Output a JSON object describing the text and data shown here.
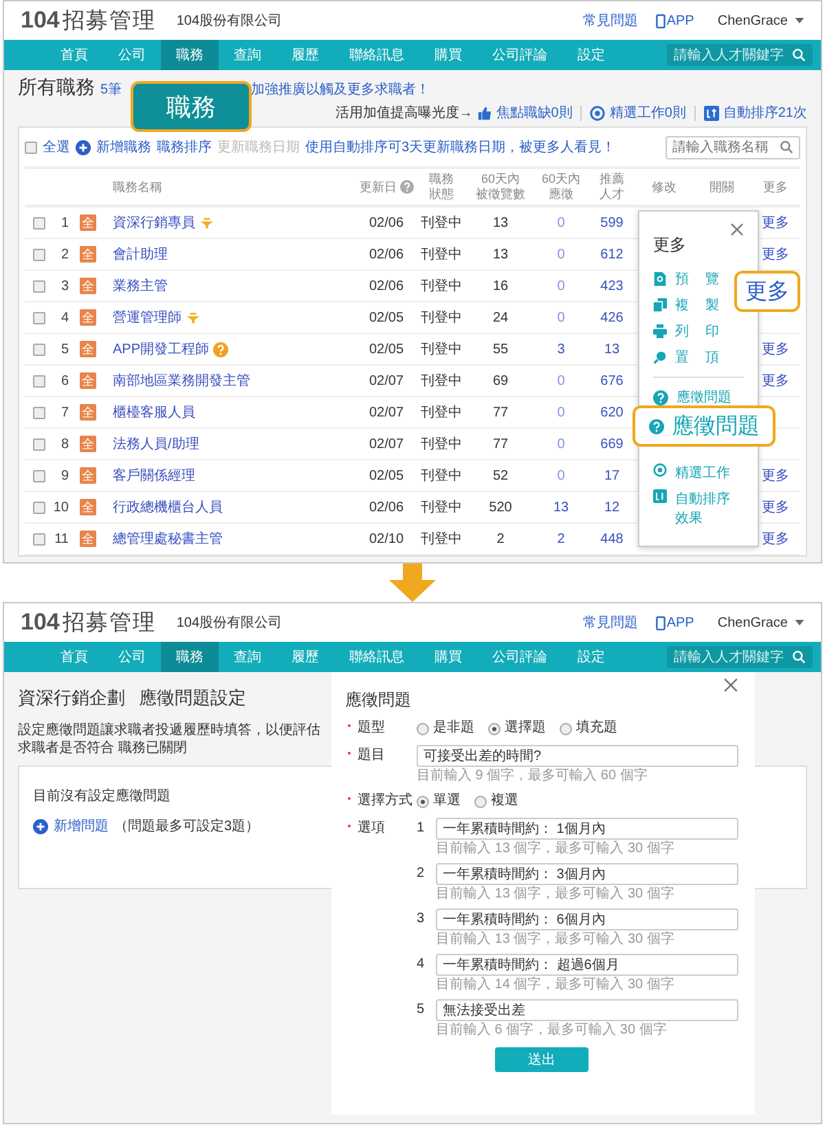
{
  "top": {
    "header": {
      "logo_number": "104",
      "logo_text": "招募管理",
      "company": "104股份有限公司",
      "faq": "常見問題",
      "app": "APP",
      "user": "ChenGrace"
    },
    "nav": {
      "items": [
        {
          "label": "首頁",
          "selected": false
        },
        {
          "label": "公司",
          "selected": false
        },
        {
          "label": "職務",
          "selected": true
        },
        {
          "label": "查詢",
          "selected": false
        },
        {
          "label": "履歷",
          "selected": false
        },
        {
          "label": "聯絡訊息",
          "selected": false
        },
        {
          "label": "購買",
          "selected": false
        },
        {
          "label": "公司評論",
          "selected": false
        },
        {
          "label": "設定",
          "selected": false
        }
      ],
      "search_placeholder": "請輸入人才關鍵字"
    },
    "page_title": "所有職務",
    "promo_start": "5筆",
    "promo_end": "加強推廣以觸及更多求職者！",
    "boost_label": "活用加值提高曝光度→",
    "boost_links": [
      "焦點職缺0則",
      "精選工作0則",
      "自動排序21次"
    ],
    "toolbar": {
      "select_all": "全選",
      "checked": false,
      "add": "新增職務",
      "sort": "職務排序",
      "update": "更新職務日期",
      "update_disabled": true,
      "tip": "使用自動排序可3天更新職務日期，被更多人看見！",
      "search_placeholder": "請輸入職務名稱"
    },
    "table": {
      "columns": [
        "職務名稱",
        "更新日",
        "職務狀態",
        "60天內被徵覽數",
        "60天內應徵",
        "推薦人才",
        "修改",
        "開關",
        "更多"
      ],
      "rows": [
        {
          "num": "1",
          "checked": false,
          "badge": "全",
          "name": "資深行銷專員",
          "featured": true,
          "date": "02/06",
          "status": "刊登中",
          "views": "13",
          "applied": "0",
          "recommend": "599",
          "more": "更多"
        },
        {
          "num": "2",
          "checked": false,
          "badge": "全",
          "name": "會計助理",
          "date": "02/06",
          "status": "刊登中",
          "views": "13",
          "applied": "0",
          "recommend": "612",
          "more": "更多"
        },
        {
          "num": "3",
          "checked": false,
          "badge": "全",
          "name": "業務主管",
          "date": "02/06",
          "status": "刊登中",
          "views": "16",
          "applied": "0",
          "recommend": "423"
        },
        {
          "num": "4",
          "checked": false,
          "badge": "全",
          "name": "營運管理師",
          "featured": true,
          "date": "02/05",
          "status": "刊登中",
          "views": "24",
          "applied": "0",
          "recommend": "426"
        },
        {
          "num": "5",
          "checked": false,
          "badge": "全",
          "name": "APP開發工程師",
          "has_questions": true,
          "date": "02/05",
          "status": "刊登中",
          "views": "55",
          "applied": "3",
          "recommend": "13",
          "more": "更多"
        },
        {
          "num": "6",
          "checked": false,
          "badge": "全",
          "name": "南部地區業務開發主管",
          "date": "02/07",
          "status": "刊登中",
          "views": "69",
          "applied": "0",
          "recommend": "676",
          "more": "更多"
        },
        {
          "num": "7",
          "checked": false,
          "badge": "全",
          "name": "櫃檯客服人員",
          "date": "02/07",
          "status": "刊登中",
          "views": "77",
          "applied": "0",
          "recommend": "620"
        },
        {
          "num": "8",
          "checked": false,
          "badge": "全",
          "name": "法務人員/助理",
          "date": "02/07",
          "status": "刊登中",
          "views": "77",
          "applied": "0",
          "recommend": "669"
        },
        {
          "num": "9",
          "checked": false,
          "badge": "全",
          "name": "客戶關係經理",
          "date": "02/05",
          "status": "刊登中",
          "views": "52",
          "applied": "0",
          "recommend": "17",
          "more": "更多"
        },
        {
          "num": "10",
          "checked": false,
          "badge": "全",
          "name": "行政總機櫃台人員",
          "date": "02/06",
          "status": "刊登中",
          "views": "520",
          "applied": "13",
          "recommend": "12",
          "more": "更多"
        },
        {
          "num": "11",
          "checked": false,
          "badge": "全",
          "name": "總管理處秘書主管",
          "date": "02/10",
          "status": "刊登中",
          "views": "2",
          "applied": "2",
          "recommend": "448",
          "more": "更多"
        }
      ]
    },
    "more_menu": {
      "title": "更多",
      "items": [
        "預覽",
        "複製",
        "列印",
        "置頂"
      ],
      "question": "應徵問題",
      "extras": [
        "精選工作",
        "自動排序效果"
      ]
    },
    "callouts": {
      "nav": "職務",
      "more": "更多",
      "question": "應徵問題"
    }
  },
  "bottom": {
    "header": {
      "logo_number": "104",
      "logo_text": "招募管理",
      "company": "104股份有限公司",
      "faq": "常見問題",
      "app": "APP",
      "user": "ChenGrace"
    },
    "nav": {
      "items": [
        {
          "label": "首頁",
          "selected": false
        },
        {
          "label": "公司",
          "selected": false
        },
        {
          "label": "職務",
          "selected": true
        },
        {
          "label": "查詢",
          "selected": false
        },
        {
          "label": "履歷",
          "selected": false
        },
        {
          "label": "聯絡訊息",
          "selected": false
        },
        {
          "label": "購買",
          "selected": false
        },
        {
          "label": "公司評論",
          "selected": false
        },
        {
          "label": "設定",
          "selected": false
        }
      ],
      "search_placeholder": "請輸入人才關鍵字"
    },
    "job_title": "資深行銷企劃",
    "page_title": "應徵問題設定",
    "description": "設定應徵問題讓求職者投遞履歷時填答，以便評估求職者是否符合 職務已關閉",
    "empty_note": "目前沒有設定應徵問題",
    "add_question": "新增問題",
    "add_hint": "（問題最多可設定3題）",
    "modal": {
      "title": "應徵問題",
      "type_label": "題型",
      "types": [
        {
          "label": "是非題",
          "selected": false
        },
        {
          "label": "選擇題",
          "selected": true
        },
        {
          "label": "填充題",
          "selected": false
        }
      ],
      "question_label": "題目",
      "question": "可接受出差的時間?",
      "question_hint": "目前輸入 9 個字，最多可輸入 60 個字",
      "mode_label": "選擇方式",
      "modes": [
        {
          "label": "單選",
          "selected": true
        },
        {
          "label": "複選",
          "selected": false
        }
      ],
      "options_label": "選項",
      "options": [
        {
          "num": "1",
          "value": "一年累積時間約： 1個月內",
          "hint": "目前輸入 13 個字，最多可輸入 30 個字"
        },
        {
          "num": "2",
          "value": "一年累積時間約： 3個月內",
          "hint": "目前輸入 13 個字，最多可輸入 30 個字"
        },
        {
          "num": "3",
          "value": "一年累積時間約： 6個月內",
          "hint": "目前輸入 13 個字，最多可輸入 30 個字"
        },
        {
          "num": "4",
          "value": "一年累積時間約： 超過6個月",
          "hint": "目前輸入 14 個字，最多可輸入 30 個字"
        },
        {
          "num": "5",
          "value": "無法接受出差",
          "hint": "目前輸入 6 個字，最多可輸入 30 個字"
        }
      ],
      "submit": "送出"
    }
  }
}
